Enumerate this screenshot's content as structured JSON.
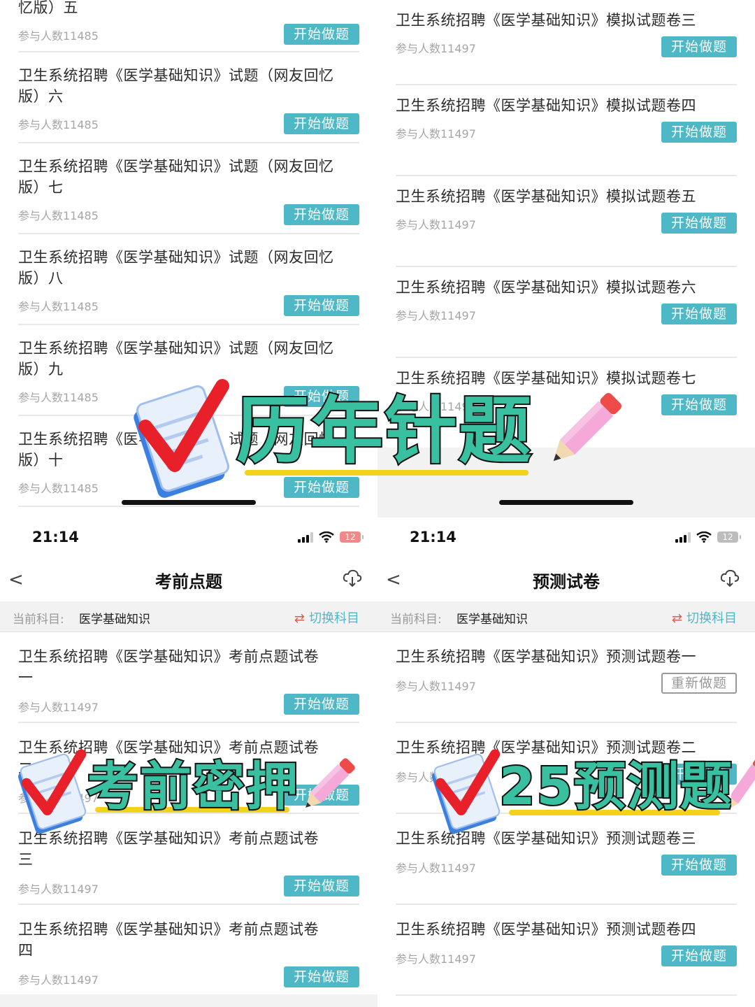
{
  "top_left": {
    "items": [
      {
        "title": "忆版）五",
        "meta": "参与人数11485",
        "button": "开始做题"
      },
      {
        "title": "卫生系统招聘《医学基础知识》试题（网友回忆版）六",
        "meta": "参与人数11485",
        "button": "开始做题"
      },
      {
        "title": "卫生系统招聘《医学基础知识》试题（网友回忆版）七",
        "meta": "参与人数11485",
        "button": "开始做题"
      },
      {
        "title": "卫生系统招聘《医学基础知识》试题（网友回忆版）八",
        "meta": "参与人数11485",
        "button": "开始做题"
      },
      {
        "title": "卫生系统招聘《医学基础知识》试题（网友回忆版）九",
        "meta": "参与人数11485",
        "button": "开始做题"
      },
      {
        "title": "卫生系统招聘《医学基础知识》试题（网友回忆版）十",
        "meta": "参与人数11485",
        "button": "开始做题"
      }
    ]
  },
  "top_right": {
    "items": [
      {
        "title": "卫生系统招聘《医学基础知识》模拟试题卷三",
        "meta": "参与人数11497",
        "button": "开始做题"
      },
      {
        "title": "卫生系统招聘《医学基础知识》模拟试题卷四",
        "meta": "参与人数11497",
        "button": "开始做题"
      },
      {
        "title": "卫生系统招聘《医学基础知识》模拟试题卷五",
        "meta": "参与人数11497",
        "button": "开始做题"
      },
      {
        "title": "卫生系统招聘《医学基础知识》模拟试题卷六",
        "meta": "参与人数11497",
        "button": "开始做题"
      },
      {
        "title": "卫生系统招聘《医学基础知识》模拟试题卷七",
        "meta": "参与人数11497",
        "button": "开始做题"
      }
    ]
  },
  "bottom_left": {
    "status": {
      "time": "21:14",
      "battery": "12"
    },
    "nav": {
      "title": "考前点题",
      "back": "<"
    },
    "subject": {
      "label": "当前科目:",
      "value": "医学基础知识",
      "switch": "切换科目"
    },
    "items": [
      {
        "title": "卫生系统招聘《医学基础知识》考前点题试卷一",
        "meta": "参与人数11497",
        "button": "开始做题"
      },
      {
        "title": "卫生系统招聘《医学基础知识》考前点题试卷二",
        "meta": "参与人数11497",
        "button": "开始做题"
      },
      {
        "title": "卫生系统招聘《医学基础知识》考前点题试卷三",
        "meta": "参与人数11497",
        "button": "开始做题"
      },
      {
        "title": "卫生系统招聘《医学基础知识》考前点题试卷四",
        "meta": "参与人数11497",
        "button": "开始做题"
      }
    ]
  },
  "bottom_right": {
    "status": {
      "time": "21:14",
      "battery": "12"
    },
    "nav": {
      "title": "预测试卷",
      "back": "<"
    },
    "subject": {
      "label": "当前科目:",
      "value": "医学基础知识",
      "switch": "切换科目"
    },
    "items": [
      {
        "title": "卫生系统招聘《医学基础知识》预测试题卷一",
        "meta": "参与人数11497",
        "button": "重新做题"
      },
      {
        "title": "卫生系统招聘《医学基础知识》预测试题卷二",
        "meta": "参与人数11497",
        "button": "开始做题"
      },
      {
        "title": "卫生系统招聘《医学基础知识》预测试题卷三",
        "meta": "参与人数11497",
        "button": "开始做题"
      },
      {
        "title": "卫生系统招聘《医学基础知识》预测试题卷四",
        "meta": "参与人数11497",
        "button": "开始做题"
      }
    ]
  },
  "overlays": {
    "top": "历年针题",
    "bottom_left": "考前密押",
    "bottom_right": "25预测题"
  },
  "colors": {
    "accent": "#4fb8c7",
    "overlay_text": "#38c0a0",
    "underline": "#f2d21b",
    "check": "#e8202a"
  }
}
